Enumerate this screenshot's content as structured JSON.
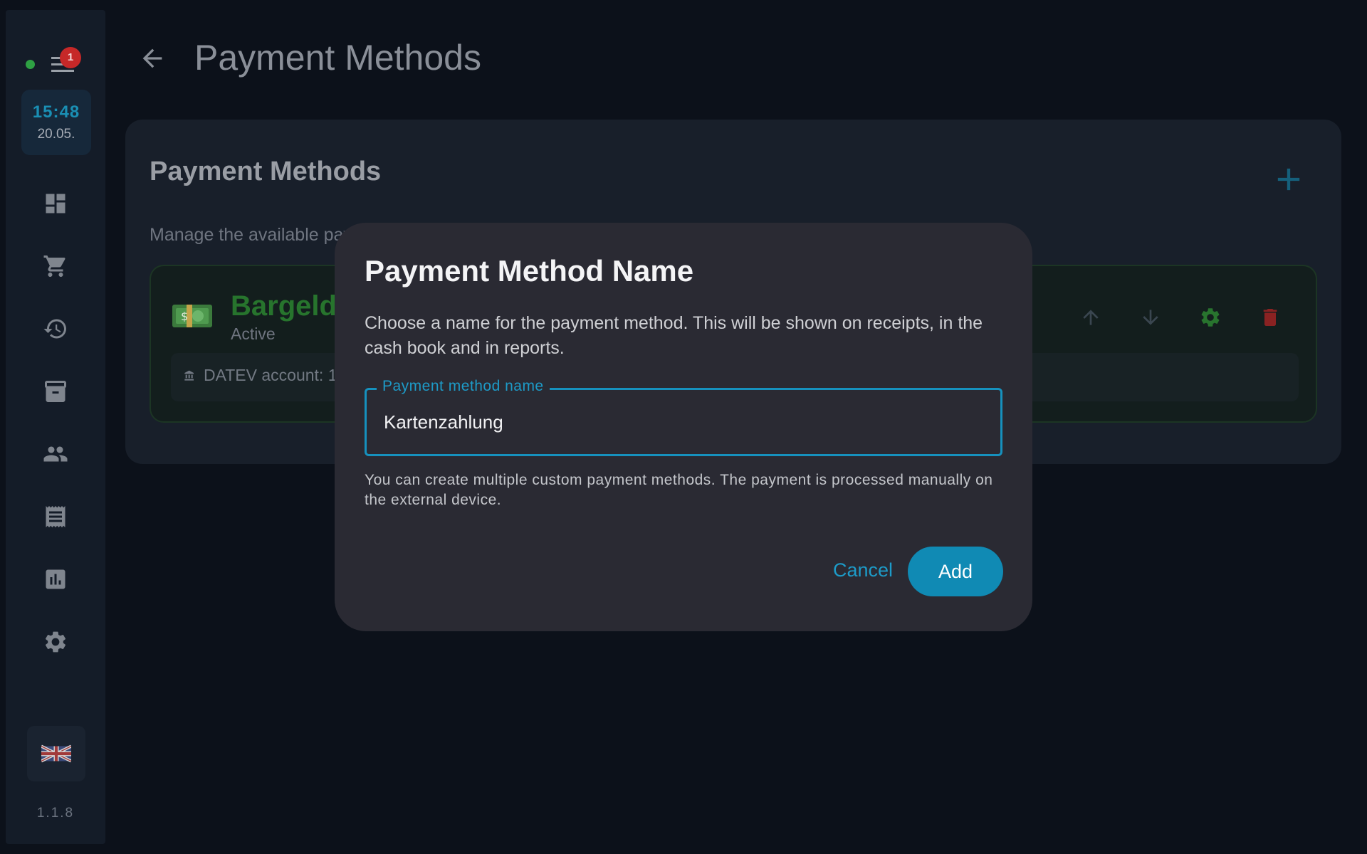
{
  "sidebar": {
    "notification_count": "1",
    "clock_time": "15:48",
    "clock_date": "20.05.",
    "nav_items": [
      {
        "icon": "dashboard-icon"
      },
      {
        "icon": "cart-icon"
      },
      {
        "icon": "history-icon"
      },
      {
        "icon": "archive-icon"
      },
      {
        "icon": "people-icon"
      },
      {
        "icon": "receipt-icon"
      },
      {
        "icon": "chart-icon"
      },
      {
        "icon": "settings-icon"
      }
    ],
    "language_flag": "uk-flag-icon",
    "version": "1.1.8"
  },
  "header": {
    "title": "Payment Methods"
  },
  "card": {
    "title": "Payment Methods",
    "subtitle": "Manage the available payment methods",
    "methods": [
      {
        "name": "Bargeld",
        "status": "Active",
        "datev": "DATEV account: 1000"
      }
    ]
  },
  "dialog": {
    "title": "Payment Method Name",
    "description": "Choose a name for the payment method. This will be shown on receipts, in the cash book and in reports.",
    "field_label": "Payment method name",
    "field_value": "Kartenzahlung",
    "helper": "You can create multiple custom payment methods. The payment is processed manually on the external device.",
    "cancel_label": "Cancel",
    "add_label": "Add"
  },
  "colors": {
    "accent": "#108ab4",
    "danger": "#c62828",
    "success": "#2ea043"
  }
}
